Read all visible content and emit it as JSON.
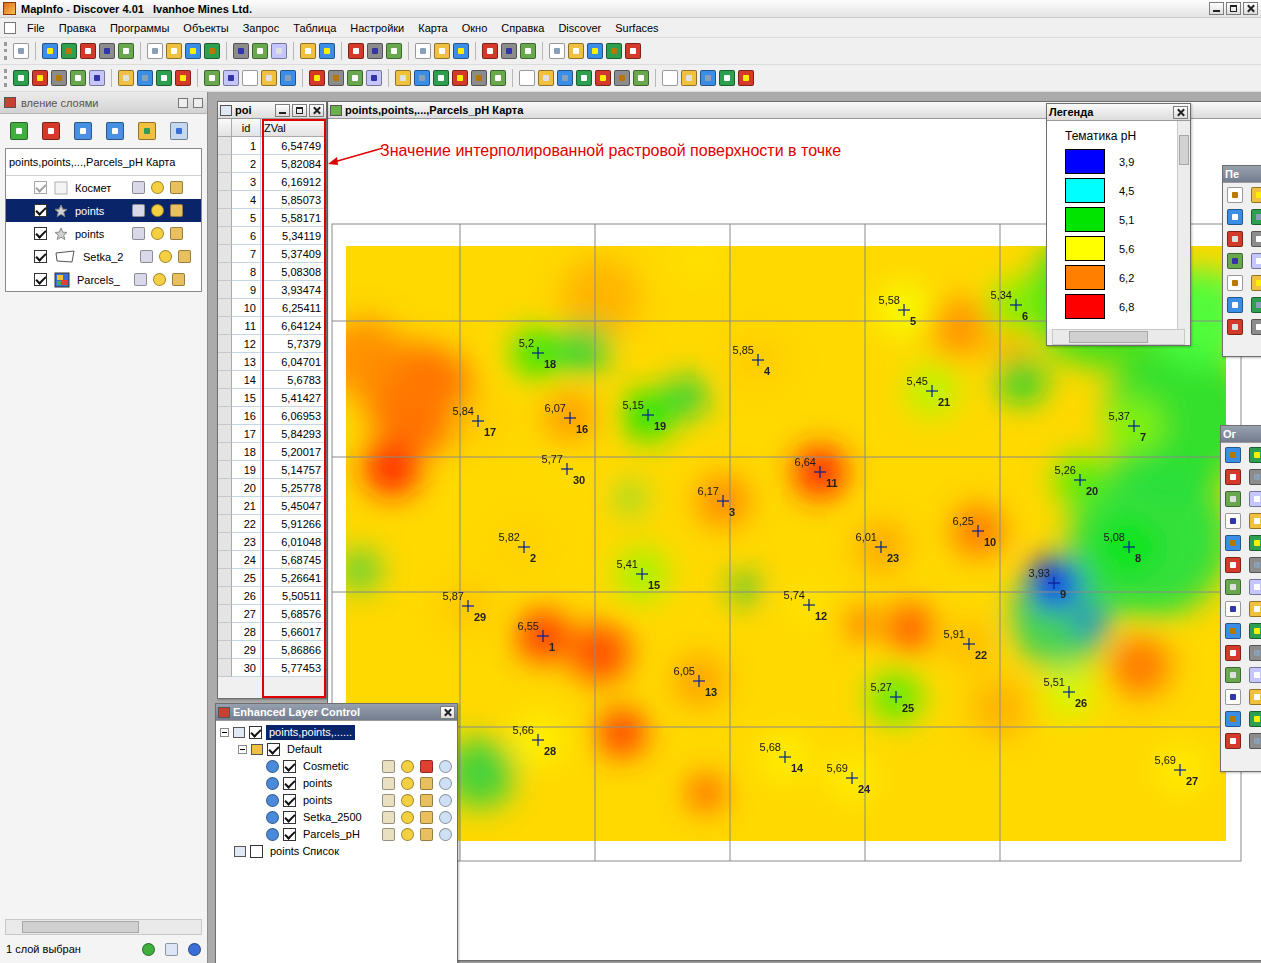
{
  "window": {
    "title": "MapInfo - Discover 4.01   Ivanhoe Mines Ltd."
  },
  "menu": [
    "File",
    "Правка",
    "Программы",
    "Объекты",
    "Запрос",
    "Таблица",
    "Настройки",
    "Карта",
    "Окно",
    "Справка",
    "Discover",
    "Surfaces"
  ],
  "layer_panel": {
    "title": "вление слоями",
    "map_title": "points,points,...,Parcels_pH Карта",
    "layers": [
      {
        "name": "Космет",
        "kind": "cosmetic",
        "checked": true,
        "disabled": true,
        "selected": false
      },
      {
        "name": "points",
        "kind": "points",
        "checked": true,
        "disabled": false,
        "selected": true
      },
      {
        "name": "points",
        "kind": "points",
        "checked": true,
        "disabled": false,
        "selected": false
      },
      {
        "name": "Setka_2",
        "kind": "region",
        "checked": true,
        "disabled": false,
        "selected": false
      },
      {
        "name": "Parcels_",
        "kind": "raster",
        "checked": true,
        "disabled": false,
        "selected": false
      }
    ],
    "status": "1 слой выбран"
  },
  "browser": {
    "title": "poi",
    "columns": [
      "id",
      "ZVal"
    ],
    "rows": [
      {
        "id": "1",
        "zval": "6,54749"
      },
      {
        "id": "2",
        "zval": "5,82084"
      },
      {
        "id": "3",
        "zval": "6,16912"
      },
      {
        "id": "4",
        "zval": "5,85073"
      },
      {
        "id": "5",
        "zval": "5,58171"
      },
      {
        "id": "6",
        "zval": "5,34119"
      },
      {
        "id": "7",
        "zval": "5,37409"
      },
      {
        "id": "8",
        "zval": "5,08308"
      },
      {
        "id": "9",
        "zval": "3,93474"
      },
      {
        "id": "10",
        "zval": "6,25411"
      },
      {
        "id": "11",
        "zval": "6,64124"
      },
      {
        "id": "12",
        "zval": "5,7379"
      },
      {
        "id": "13",
        "zval": "6,04701"
      },
      {
        "id": "14",
        "zval": "5,6783"
      },
      {
        "id": "15",
        "zval": "5,41427"
      },
      {
        "id": "16",
        "zval": "6,06953"
      },
      {
        "id": "17",
        "zval": "5,84293"
      },
      {
        "id": "18",
        "zval": "5,20017"
      },
      {
        "id": "19",
        "zval": "5,14757"
      },
      {
        "id": "20",
        "zval": "5,25778"
      },
      {
        "id": "21",
        "zval": "5,45047"
      },
      {
        "id": "22",
        "zval": "5,91266"
      },
      {
        "id": "23",
        "zval": "6,01048"
      },
      {
        "id": "24",
        "zval": "5,68745"
      },
      {
        "id": "25",
        "zval": "5,26641"
      },
      {
        "id": "26",
        "zval": "5,50511"
      },
      {
        "id": "27",
        "zval": "5,68576"
      },
      {
        "id": "28",
        "zval": "5,66017"
      },
      {
        "id": "29",
        "zval": "5,86866"
      },
      {
        "id": "30",
        "zval": "5,77453"
      }
    ]
  },
  "annotation": {
    "text": "Значение интерполированной растровой поверхности в точке"
  },
  "map": {
    "title": "points,points,...,Parcels_pH Карта",
    "points": [
      {
        "id": "5",
        "label": "5,58"
      },
      {
        "id": "6",
        "label": "5,34"
      },
      {
        "id": "18",
        "label": "5,2"
      },
      {
        "id": "4",
        "label": "5,85"
      },
      {
        "id": "21",
        "label": "5,45"
      },
      {
        "id": "17",
        "label": "5,84"
      },
      {
        "id": "16",
        "label": "6,07"
      },
      {
        "id": "19",
        "label": "5,15"
      },
      {
        "id": "7",
        "label": "5,37"
      },
      {
        "id": "30",
        "label": "5,77"
      },
      {
        "id": "11",
        "label": "6,64"
      },
      {
        "id": "20",
        "label": "5,26"
      },
      {
        "id": "3",
        "label": "6,17"
      },
      {
        "id": "10",
        "label": "6,25"
      },
      {
        "id": "2",
        "label": "5,82"
      },
      {
        "id": "23",
        "label": "6,01"
      },
      {
        "id": "8",
        "label": "5,08"
      },
      {
        "id": "15",
        "label": "5,41"
      },
      {
        "id": "9",
        "label": "3,93"
      },
      {
        "id": "29",
        "label": "5,87"
      },
      {
        "id": "12",
        "label": "5,74"
      },
      {
        "id": "1",
        "label": "6,55"
      },
      {
        "id": "22",
        "label": "5,91"
      },
      {
        "id": "13",
        "label": "6,05"
      },
      {
        "id": "25",
        "label": "5,27"
      },
      {
        "id": "26",
        "label": "5,51"
      },
      {
        "id": "28",
        "label": "5,66"
      },
      {
        "id": "14",
        "label": "5,68"
      },
      {
        "id": "24",
        "label": "5,69"
      },
      {
        "id": "27",
        "label": "5,69"
      }
    ]
  },
  "legend": {
    "title": "Легенда",
    "heading": "Тематика pH",
    "items": [
      {
        "label": "3,9",
        "color": "#0000ff"
      },
      {
        "label": "4,5",
        "color": "#00ffff"
      },
      {
        "label": "5,1",
        "color": "#00e400"
      },
      {
        "label": "5,6",
        "color": "#ffff00"
      },
      {
        "label": "6,2",
        "color": "#ff8000"
      },
      {
        "label": "6,8",
        "color": "#ff0000"
      }
    ]
  },
  "layer_control": {
    "title": "Enhanced Layer Control",
    "root": {
      "label": "points,points,......",
      "checked": true,
      "selected": true,
      "expanded": true
    },
    "group": {
      "label": "Default",
      "checked": true,
      "expanded": true
    },
    "layers": [
      {
        "name": "Cosmetic",
        "checked": true
      },
      {
        "name": "points",
        "checked": true
      },
      {
        "name": "points",
        "checked": true
      },
      {
        "name": "Setka_2500",
        "checked": true
      },
      {
        "name": "Parcels_pH",
        "checked": true
      }
    ],
    "extra": {
      "label": "points Список",
      "checked": false
    }
  },
  "toolboxes": [
    {
      "title": "Пе"
    },
    {
      "title": "Ог"
    }
  ]
}
